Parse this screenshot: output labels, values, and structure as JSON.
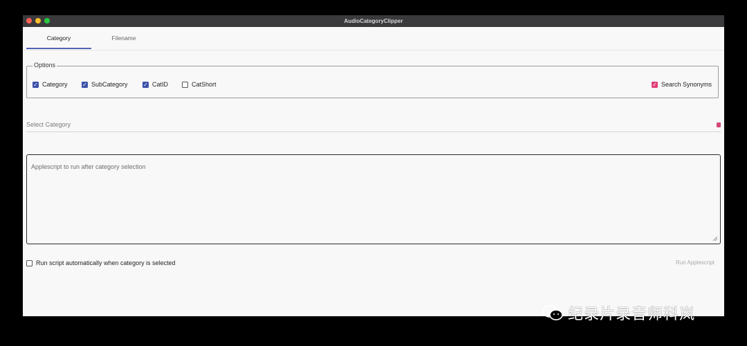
{
  "window": {
    "title": "AudioCategoryClipper",
    "traffic_lights": {
      "close": "#ff5f57",
      "minimize": "#febc2e",
      "zoom": "#28c840"
    }
  },
  "tabs": [
    {
      "label": "Category",
      "active": true
    },
    {
      "label": "Filename",
      "active": false
    }
  ],
  "options": {
    "legend": "Options",
    "checkboxes": [
      {
        "label": "Category",
        "checked": true
      },
      {
        "label": "SubCategory",
        "checked": true
      },
      {
        "label": "CatID",
        "checked": true
      },
      {
        "label": "CatShort",
        "checked": false
      }
    ],
    "search_synonyms": {
      "label": "Search Synonyms",
      "checked": true
    }
  },
  "select_category": {
    "placeholder": "Select Category"
  },
  "script_box": {
    "placeholder": "Applescript to run after category selection"
  },
  "auto_run": {
    "label": "Run script automatically when category is selected",
    "checked": false
  },
  "run_button": {
    "label": "Run Applescript"
  },
  "watermark": {
    "text": "纪录片录音师科岚"
  },
  "colors": {
    "accent": "#3d51a8",
    "pink_accent": "#e2407a",
    "tab_indicator": "#5064b4",
    "window_bg": "#f8f8f8",
    "titlebar_bg": "#3a3a3c"
  }
}
